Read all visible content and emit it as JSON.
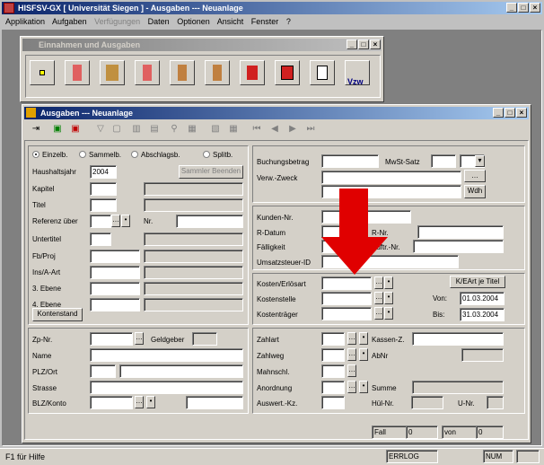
{
  "app": {
    "title": "HISFSV-GX  [ Universität Siegen ] - Ausgaben --- Neuanlage",
    "menu": [
      "Applikation",
      "Aufgaben",
      "Verfügungen",
      "Daten",
      "Optionen",
      "Ansicht",
      "Fenster",
      "?"
    ],
    "status": {
      "left": "F1 für Hilfe",
      "log": "ERRLOG",
      "num": "NUM"
    }
  },
  "einnahmen": {
    "title": "Einnahmen und Ausgaben",
    "vzw": "Vzw"
  },
  "ausgaben": {
    "title": "Ausgaben --- Neuanlage",
    "left": {
      "radios": [
        "Einzelb.",
        "Sammelb.",
        "Abschlagsb.",
        "Splitb."
      ],
      "haushaltsjahr_label": "Haushaltsjahr",
      "haushaltsjahr": "2004",
      "sammler_button": "Sammler Beenden",
      "labels": [
        "Kapitel",
        "Titel",
        "Referenz über",
        "Untertitel",
        "Fb/Proj",
        "Ins/A-Art",
        "3. Ebene",
        "4. Ebene"
      ],
      "nr_label": "Nr.",
      "kontenstand": "Kontenstand"
    },
    "right1": {
      "buchungsbetrag": "Buchungsbetrag",
      "mwst": "MwSt-Satz",
      "verwzweck": "Verw.-Zweck",
      "wdh": "Wdh"
    },
    "right2": {
      "kunden": "Kunden-Nr.",
      "rdatum": "R-Datum",
      "rnr": "R-Nr.",
      "faelligkeit": "Fälligkeit",
      "auftr": "Auftr.-Nr.",
      "umsatz": "Umsatzsteuer-ID"
    },
    "right3": {
      "kosten": "Kosten/Erlösart",
      "kostenstelle": "Kostenstelle",
      "kostentraeger": "Kostenträger",
      "kearttitel": "K/EArt je Titel",
      "von": "Von:",
      "von_val": "01.03.2004",
      "bis": "Bis:",
      "bis_val": "31.03.2004"
    },
    "bottom_left": {
      "zp": "Zp-Nr.",
      "geldgeber": "Geldgeber",
      "name": "Name",
      "plz": "PLZ/Ort",
      "strasse": "Strasse",
      "blz": "BLZ/Konto"
    },
    "bottom_right": {
      "zahlart": "Zahlart",
      "kassenz": "Kassen-Z.",
      "zahlweg": "Zahlweg",
      "abnr": "AbNr",
      "mahnschl": "Mahnschl.",
      "anordnung": "Anordnung",
      "summe": "Summe",
      "auswert": "Auswert.-Kz.",
      "huel": "Hül-Nr.",
      "unr": "U-Nr."
    },
    "footer": {
      "fall": "Fall",
      "fall_val": "0",
      "von": "von",
      "von_val": "0"
    }
  }
}
